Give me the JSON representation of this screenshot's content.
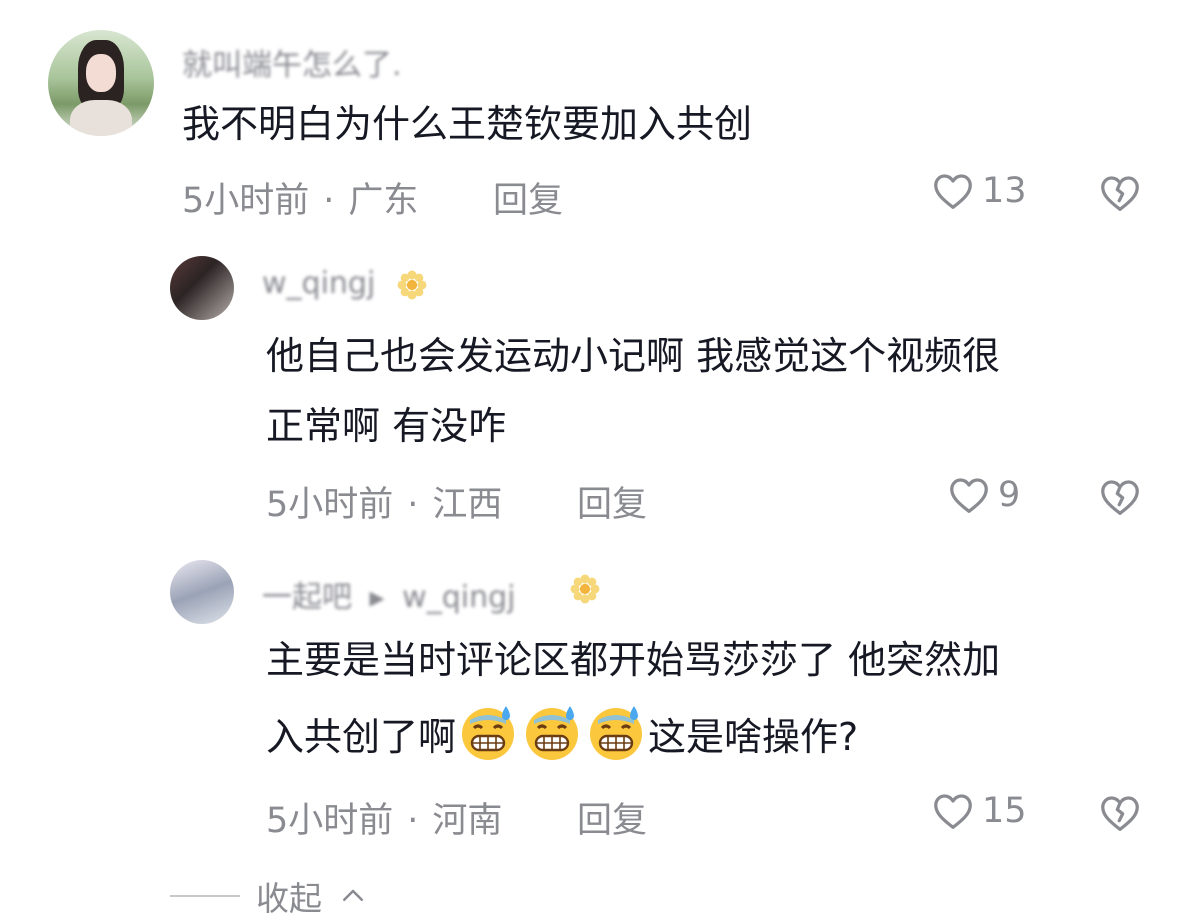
{
  "comments": [
    {
      "username": "就叫端午怎么了.",
      "text": "我不明白为什么王楚钦要加入共创",
      "time": "5小时前",
      "location": "广东",
      "reply_label": "回复",
      "likes": "13"
    },
    {
      "username": "w_qingj",
      "text_line1": "他自己也会发运动小记啊 我感觉这个视频很",
      "text_line2": "正常啊 有没咋",
      "time": "5小时前",
      "location": "江西",
      "reply_label": "回复",
      "likes": "9"
    },
    {
      "username": "一起吧",
      "reply_to": "w_qingj",
      "text_line1": "主要是当时评论区都开始骂莎莎了 他突然加",
      "text_line2_before": "入共创了啊",
      "text_line2_after": "这是啥操作?",
      "time": "5小时前",
      "location": "河南",
      "reply_label": "回复",
      "likes": "15"
    }
  ],
  "collapse_label": "收起",
  "icons": {
    "like": "heart-outline-icon",
    "dislike": "broken-heart-icon",
    "emoji": "grimacing-sweat-emoji",
    "badge": "flower-icon",
    "collapse": "chevron-up-icon"
  },
  "colors": {
    "text": "#161823",
    "secondary": "#8a8b91"
  }
}
